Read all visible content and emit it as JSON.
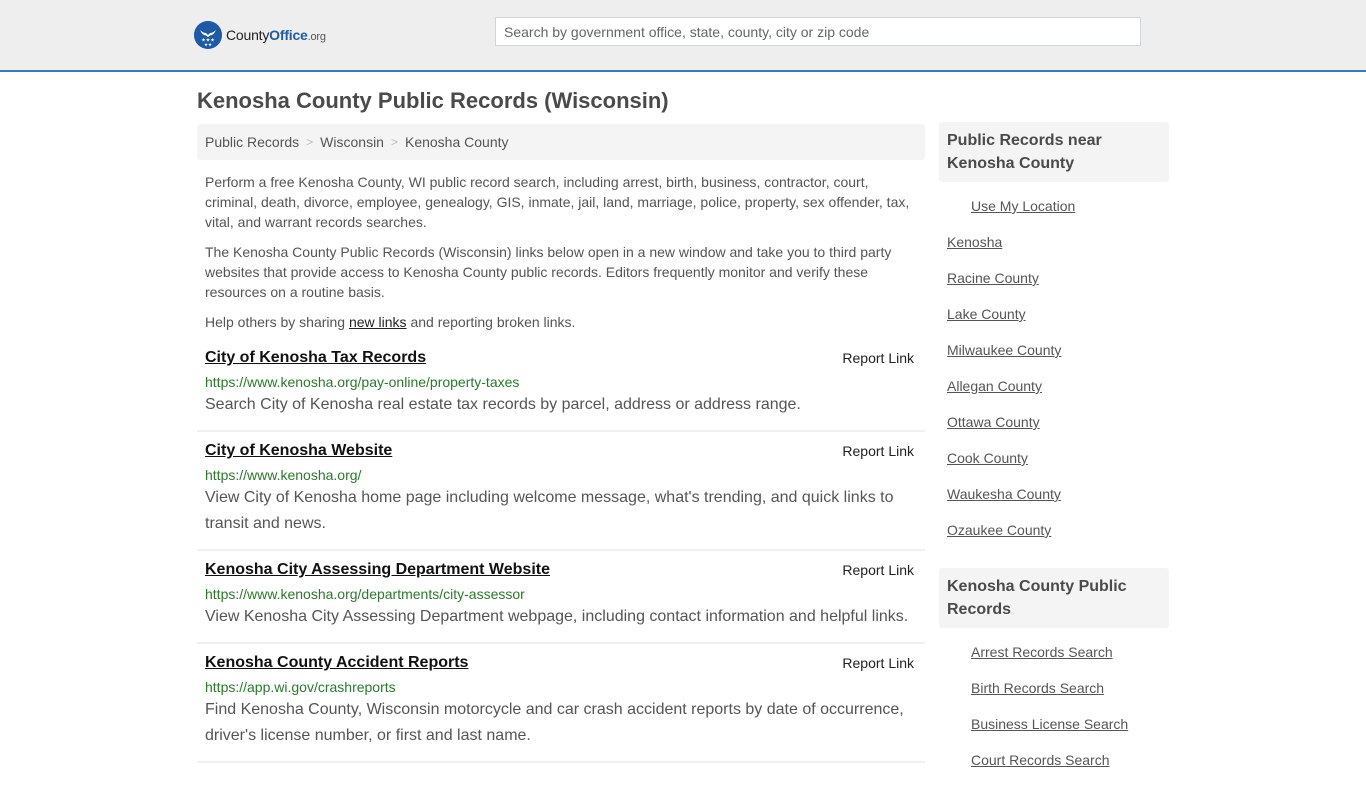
{
  "header": {
    "logo": {
      "county": "County",
      "office": "Office",
      "org": ".org",
      "icon": "eagle-stars-badge-icon"
    },
    "search": {
      "placeholder": "Search by government office, state, county, city or zip code",
      "value": ""
    },
    "colors": {
      "accent": "#337ab7",
      "brand": "#1f5aa6",
      "url_green": "#2a7a2a"
    }
  },
  "page": {
    "title": "Kenosha County Public Records (Wisconsin)"
  },
  "breadcrumb": {
    "items": [
      "Public Records",
      "Wisconsin",
      "Kenosha County"
    ],
    "separator": ">"
  },
  "intro": {
    "p1": "Perform a free Kenosha County, WI public record search, including arrest, birth, business, contractor, court, criminal, death, divorce, employee, genealogy, GIS, inmate, jail, land, marriage, police, property, sex offender, tax, vital, and warrant records searches.",
    "p2": "The Kenosha County Public Records (Wisconsin) links below open in a new window and take you to third party websites that provide access to Kenosha County public records. Editors frequently monitor and verify these resources on a routine basis.",
    "p3_before": "Help others by sharing ",
    "p3_link": "new links",
    "p3_after": " and reporting broken links."
  },
  "records": [
    {
      "title": "City of Kenosha Tax Records",
      "report": "Report Link",
      "url": "https://www.kenosha.org/pay-online/property-taxes",
      "desc": "Search City of Kenosha real estate tax records by parcel, address or address range."
    },
    {
      "title": "City of Kenosha Website",
      "report": "Report Link",
      "url": "https://www.kenosha.org/",
      "desc": "View City of Kenosha home page including welcome message, what's trending, and quick links to transit and news."
    },
    {
      "title": "Kenosha City Assessing Department Website",
      "report": "Report Link",
      "url": "https://www.kenosha.org/departments/city-assessor",
      "desc": "View Kenosha City Assessing Department webpage, including contact information and helpful links."
    },
    {
      "title": "Kenosha County Accident Reports",
      "report": "Report Link",
      "url": "https://app.wi.gov/crashreports",
      "desc": "Find Kenosha County, Wisconsin motorcycle and car crash accident reports by date of occurrence, driver's license number, or first and last name."
    }
  ],
  "sidebar": {
    "nearby": {
      "title": "Public Records near Kenosha County",
      "use_location": "Use My Location",
      "items": [
        "Kenosha",
        "Racine County",
        "Lake County",
        "Milwaukee County",
        "Allegan County",
        "Ottawa County",
        "Cook County",
        "Waukesha County",
        "Ozaukee County"
      ]
    },
    "county_records": {
      "title": "Kenosha County Public Records",
      "items": [
        "Arrest Records Search",
        "Birth Records Search",
        "Business License Search",
        "Court Records Search"
      ]
    }
  }
}
